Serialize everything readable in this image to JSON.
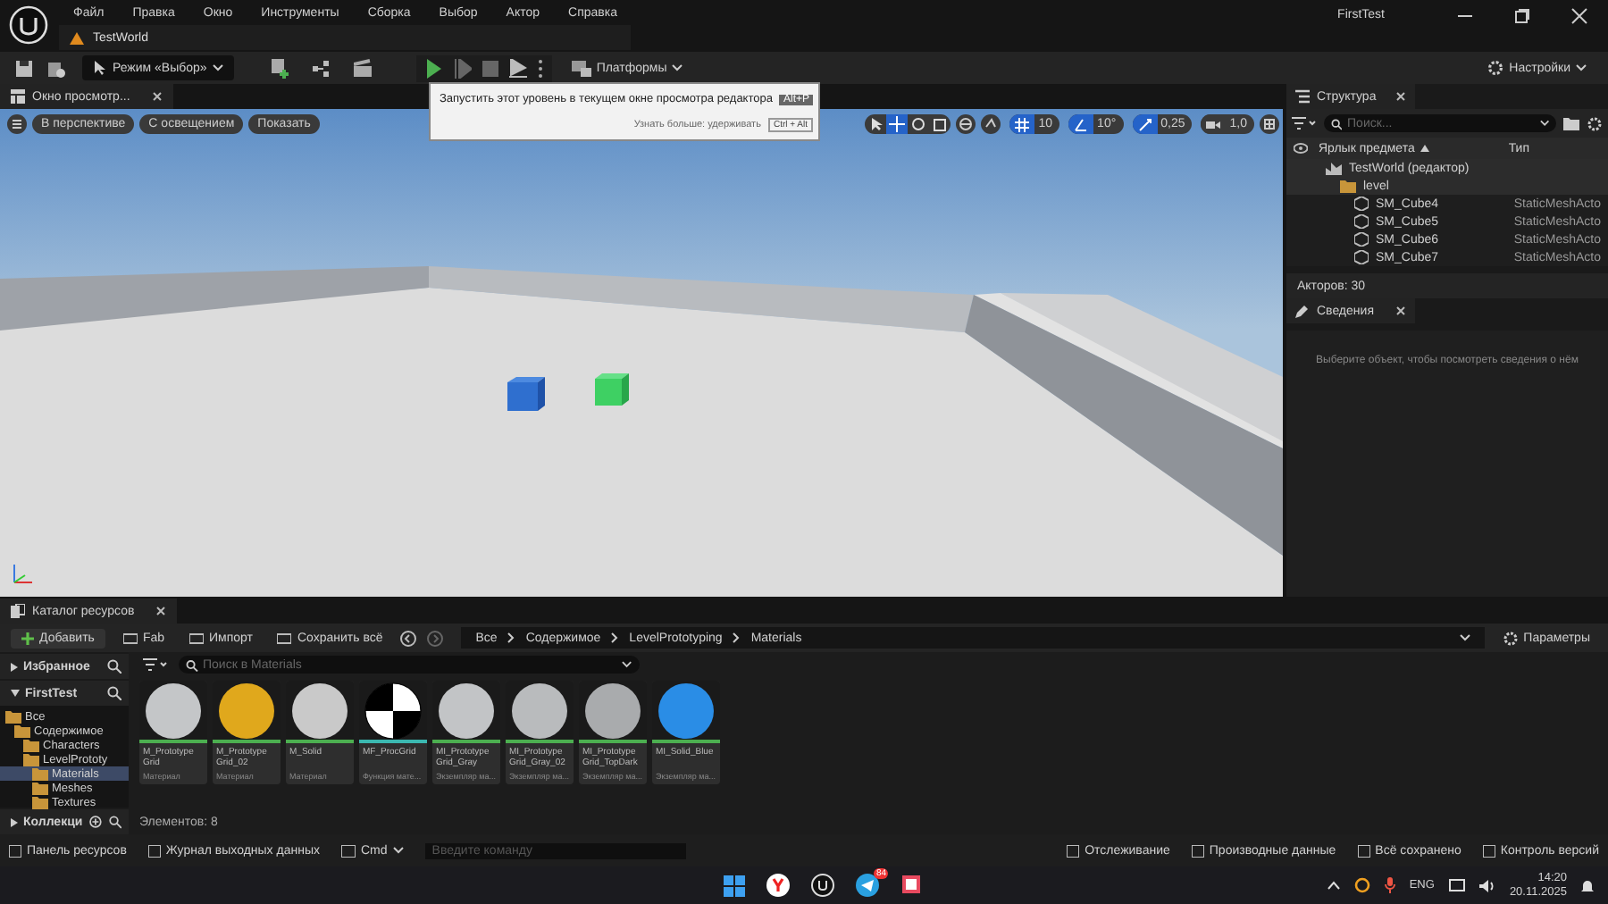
{
  "menu": [
    "Файл",
    "Правка",
    "Окно",
    "Инструменты",
    "Сборка",
    "Выбор",
    "Актор",
    "Справка"
  ],
  "app_title": "FirstTest",
  "level_tab": "TestWorld",
  "toolbar": {
    "mode": "Режим «Выбор»",
    "platforms": "Платформы",
    "settings": "Настройки"
  },
  "tooltip": {
    "text": "Запустить этот уровень в текущем окне просмотра редактора",
    "shortcut": "Alt+P",
    "hint": "Узнать больше: удерживать",
    "hint_shortcut": "Ctrl + Alt"
  },
  "viewport": {
    "tab": "Окно просмотр...",
    "buttons": [
      "В перспективе",
      "С освещением",
      "Показать"
    ],
    "tools": [
      {
        "kind": "select",
        "selected": false
      },
      {
        "kind": "move",
        "selected": true
      },
      {
        "kind": "rotate",
        "selected": false
      },
      {
        "kind": "scale",
        "selected": false
      }
    ],
    "snaps": [
      {
        "kind": "grid",
        "value": "10",
        "on": true
      },
      {
        "kind": "angle",
        "value": "10°",
        "on": true
      },
      {
        "kind": "scale",
        "value": "0,25",
        "on": true
      },
      {
        "kind": "camera",
        "value": "1,0",
        "on": false
      }
    ]
  },
  "outliner": {
    "tab": "Структура",
    "search_placeholder": "Поиск...",
    "columns": [
      "Ярлык предмета",
      "Тип"
    ],
    "tree": [
      {
        "label": "TestWorld (редактор)",
        "kind": "world",
        "children": [
          {
            "label": "level",
            "kind": "folder",
            "children": [
              {
                "label": "SM_Cube4",
                "kind": "mesh",
                "type": "StaticMeshActo"
              },
              {
                "label": "SM_Cube5",
                "kind": "mesh",
                "type": "StaticMeshActo"
              },
              {
                "label": "SM_Cube6",
                "kind": "mesh",
                "type": "StaticMeshActo"
              },
              {
                "label": "SM_Cube7",
                "kind": "mesh",
                "type": "StaticMeshActo"
              }
            ]
          }
        ]
      }
    ],
    "actor_count": "Акторов: 30"
  },
  "details": {
    "tab": "Сведения",
    "hint": "Выберите объект, чтобы посмотреть сведения о нём"
  },
  "content_browser": {
    "tab": "Каталог ресурсов",
    "add": "Добавить",
    "buttons": [
      "Fab",
      "Импорт",
      "Сохранить всё"
    ],
    "breadcrumb": [
      "Все",
      "Содержимое",
      "LevelPrototyping",
      "Materials"
    ],
    "settings": "Параметры",
    "favorites": "Избранное",
    "project": "FirstTest",
    "collections": "Коллекци",
    "tree": [
      {
        "label": "Все",
        "selected": false,
        "children": [
          {
            "label": "Содержимое",
            "selected": false,
            "children": [
              {
                "label": "Characters",
                "selected": false
              },
              {
                "label": "LevelPrototy",
                "selected": false,
                "children": [
                  {
                    "label": "Materials",
                    "selected": true
                  },
                  {
                    "label": "Meshes",
                    "selected": false
                  },
                  {
                    "label": "Textures",
                    "selected": false
                  }
                ]
              }
            ]
          }
        ]
      }
    ],
    "search_placeholder": "Поиск в Materials",
    "assets": [
      {
        "name": "M_Prototype Grid",
        "type": "Материал",
        "kind": "material",
        "color": "#c4c6c8"
      },
      {
        "name": "M_Prototype Grid_02",
        "type": "Материал",
        "kind": "material",
        "color": "#e0a81c"
      },
      {
        "name": "M_Solid",
        "type": "Материал",
        "kind": "material",
        "color": "#c9c9c9"
      },
      {
        "name": "MF_ProcGrid",
        "type": "Функция мате...",
        "kind": "function",
        "color": "#ffffff"
      },
      {
        "name": "MI_Prototype Grid_Gray",
        "type": "Экземпляр ма...",
        "kind": "material",
        "color": "#c2c4c6"
      },
      {
        "name": "MI_Prototype Grid_Gray_02",
        "type": "Экземпляр ма...",
        "kind": "material",
        "color": "#b9bbbd"
      },
      {
        "name": "MI_Prototype Grid_TopDark",
        "type": "Экземпляр ма...",
        "kind": "material",
        "color": "#a9abad"
      },
      {
        "name": "MI_Solid_Blue",
        "type": "Экземпляр ма...",
        "kind": "material",
        "color": "#2a8de6"
      }
    ],
    "count": "Элементов: 8"
  },
  "status_bar": {
    "left": [
      "Панель ресурсов",
      "Журнал выходных данных"
    ],
    "cmd": "Cmd",
    "cmd_placeholder": "Введите команду",
    "right": [
      "Отслеживание",
      "Производные данные",
      "Всё сохранено",
      "Контроль версий"
    ]
  },
  "taskbar": {
    "badge": "84",
    "language": "ENG",
    "time": "14:20",
    "date": "20.11.2025"
  }
}
